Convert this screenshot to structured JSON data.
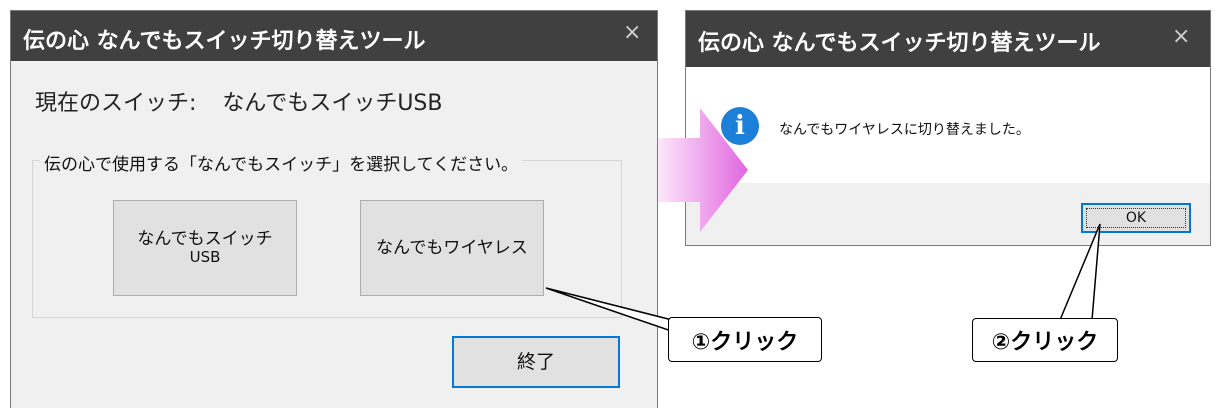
{
  "app_title": "伝の心 なんでもスイッチ切り替えツール",
  "close_glyph": "×",
  "main_window": {
    "current_label": "現在のスイッチ:",
    "current_value": "なんでもスイッチUSB",
    "group_label": "伝の心で使用する「なんでもスイッチ」を選択してください。",
    "button_usb_line1": "なんでもスイッチ",
    "button_usb_line2": "USB",
    "button_wireless": "なんでもワイヤレス",
    "button_exit": "終了"
  },
  "dialog": {
    "icon": "info-icon",
    "icon_glyph": "i",
    "message": "なんでもワイヤレスに切り替えました。",
    "ok_label": "OK"
  },
  "annotations": {
    "step1": "①クリック",
    "step2": "②クリック"
  },
  "colors": {
    "titlebar": "#404040",
    "info_icon": "#1c7fd8",
    "focus_border": "#0078d7",
    "arrow_light": "#fce4f8",
    "arrow_dark": "#e066e0"
  }
}
